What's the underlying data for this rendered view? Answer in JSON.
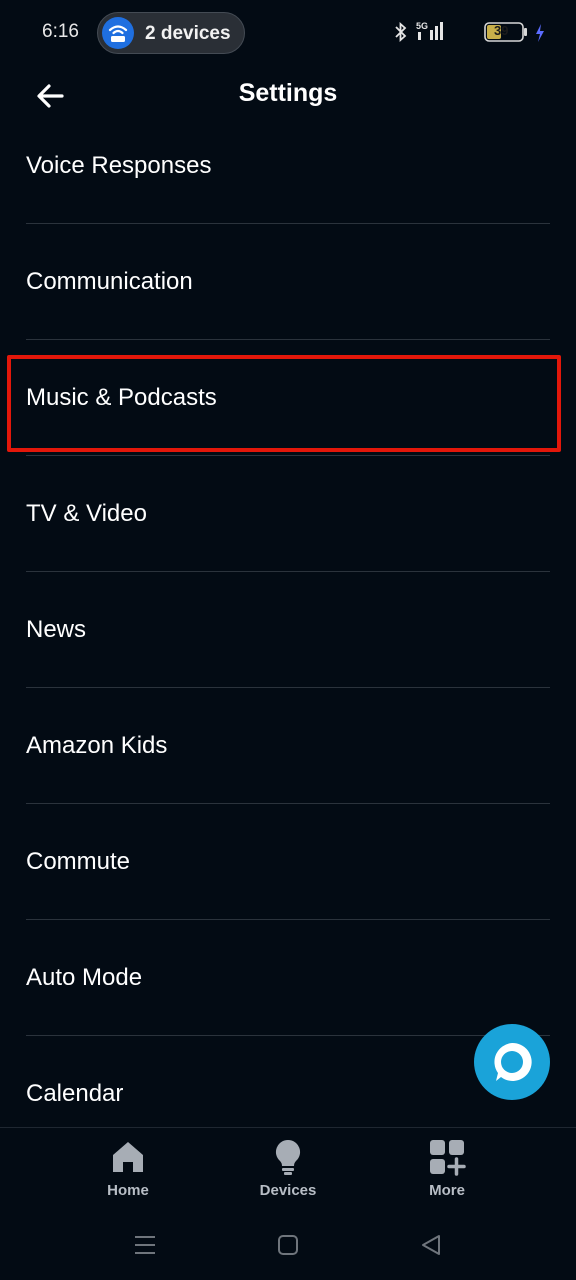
{
  "status_bar": {
    "time": "6:16",
    "devices_pill": "2 devices",
    "battery_level": "39",
    "network": "5G",
    "icons": [
      "wifi-router-icon",
      "bluetooth-icon",
      "signal-icon",
      "battery-icon",
      "charging-icon"
    ]
  },
  "header": {
    "title": "Settings",
    "back_icon": "arrow-left-icon"
  },
  "settings_items": [
    {
      "label": "Voice Responses"
    },
    {
      "label": "Communication"
    },
    {
      "label": "Music & Podcasts",
      "highlighted": true
    },
    {
      "label": "TV & Video"
    },
    {
      "label": "News"
    },
    {
      "label": "Amazon Kids"
    },
    {
      "label": "Commute"
    },
    {
      "label": "Auto Mode"
    },
    {
      "label": "Calendar"
    }
  ],
  "bottom_nav": {
    "items": [
      {
        "label": "Home",
        "icon": "home-icon"
      },
      {
        "label": "Devices",
        "icon": "lightbulb-icon"
      },
      {
        "label": "More",
        "icon": "grid-plus-icon"
      }
    ]
  },
  "colors": {
    "background": "#030b14",
    "highlight": "#e3170a",
    "alexa_blue": "#1aa3d9",
    "divider": "#2b333c",
    "nav_label": "#b8bec6"
  }
}
